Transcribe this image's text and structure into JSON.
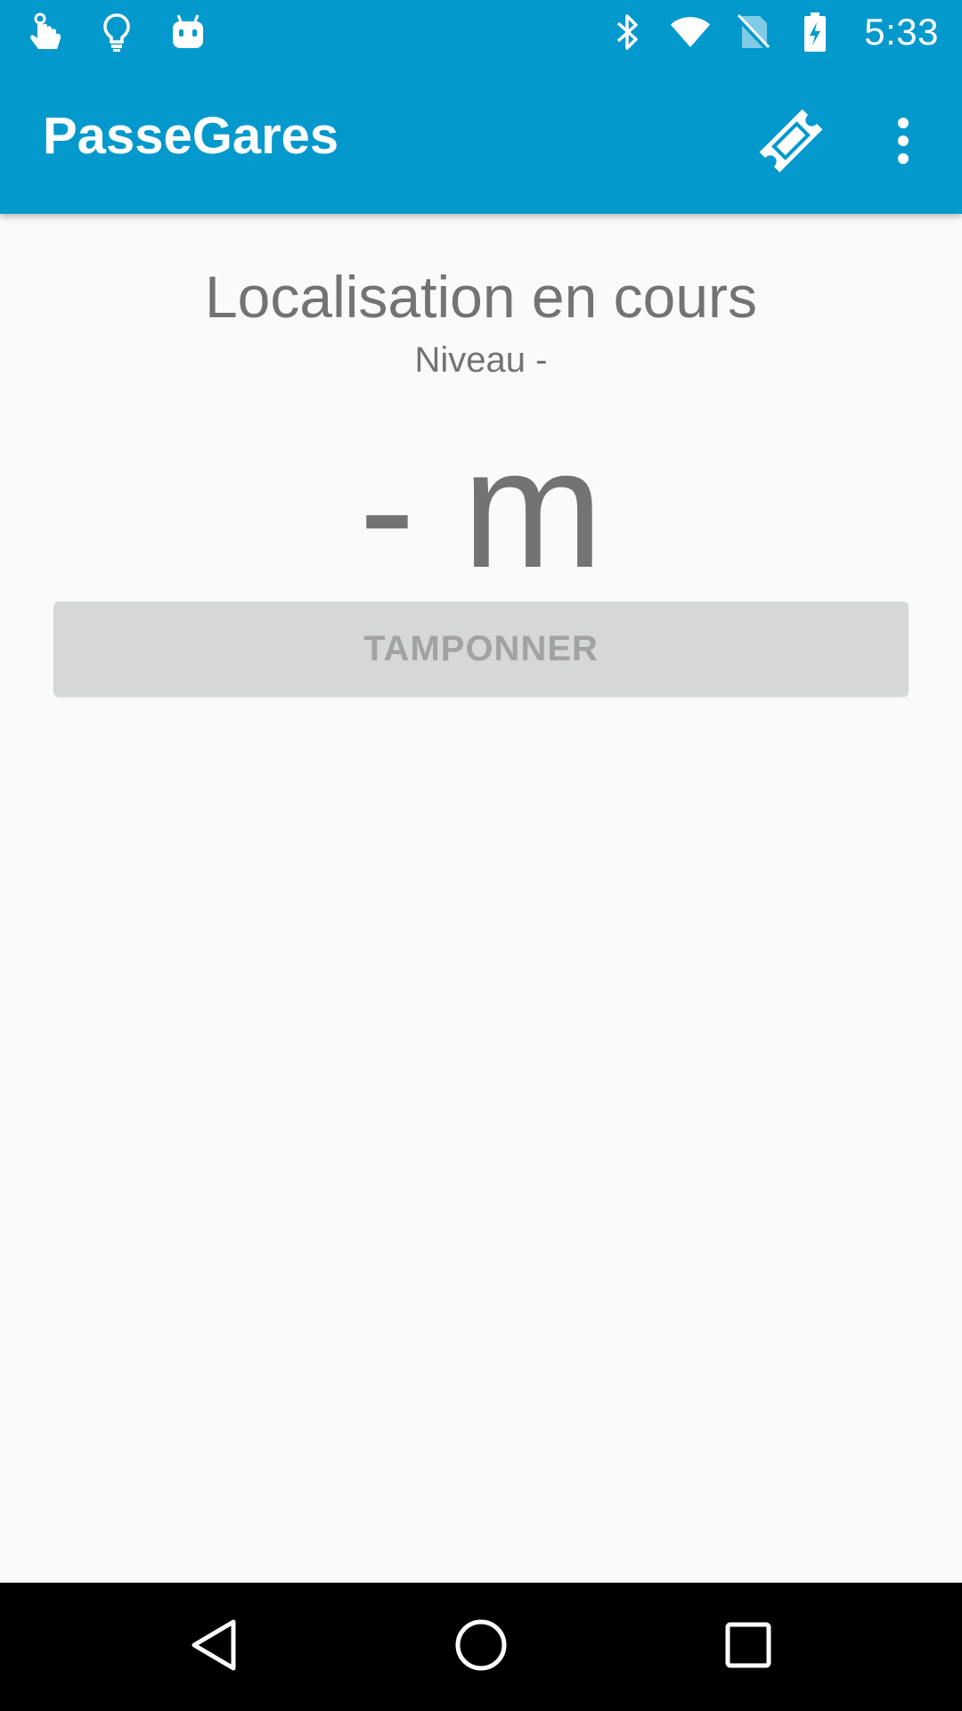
{
  "status_bar": {
    "time": "5:33",
    "left_icons": [
      "touch-hand-icon",
      "lightbulb-icon",
      "android-debug-icon"
    ],
    "right_icons": [
      "bluetooth-icon",
      "wifi-icon",
      "no-sim-icon",
      "battery-charging-icon"
    ]
  },
  "app_bar": {
    "title": "PasseGares",
    "actions": [
      "ticket-icon",
      "more-vert-icon"
    ]
  },
  "main": {
    "location_status": "Localisation en cours",
    "level": "Niveau -",
    "distance": "- m",
    "stamp_button_label": "TAMPONNER",
    "stamp_button_enabled": false
  },
  "nav_bar": {
    "buttons": [
      "back-icon",
      "home-icon",
      "recents-icon"
    ]
  },
  "colors": {
    "primary": "#0399cc",
    "text_secondary": "#737373",
    "button_disabled_bg": "#d6d7d7",
    "button_disabled_text": "#a2a2a2",
    "background": "#fafafa"
  }
}
